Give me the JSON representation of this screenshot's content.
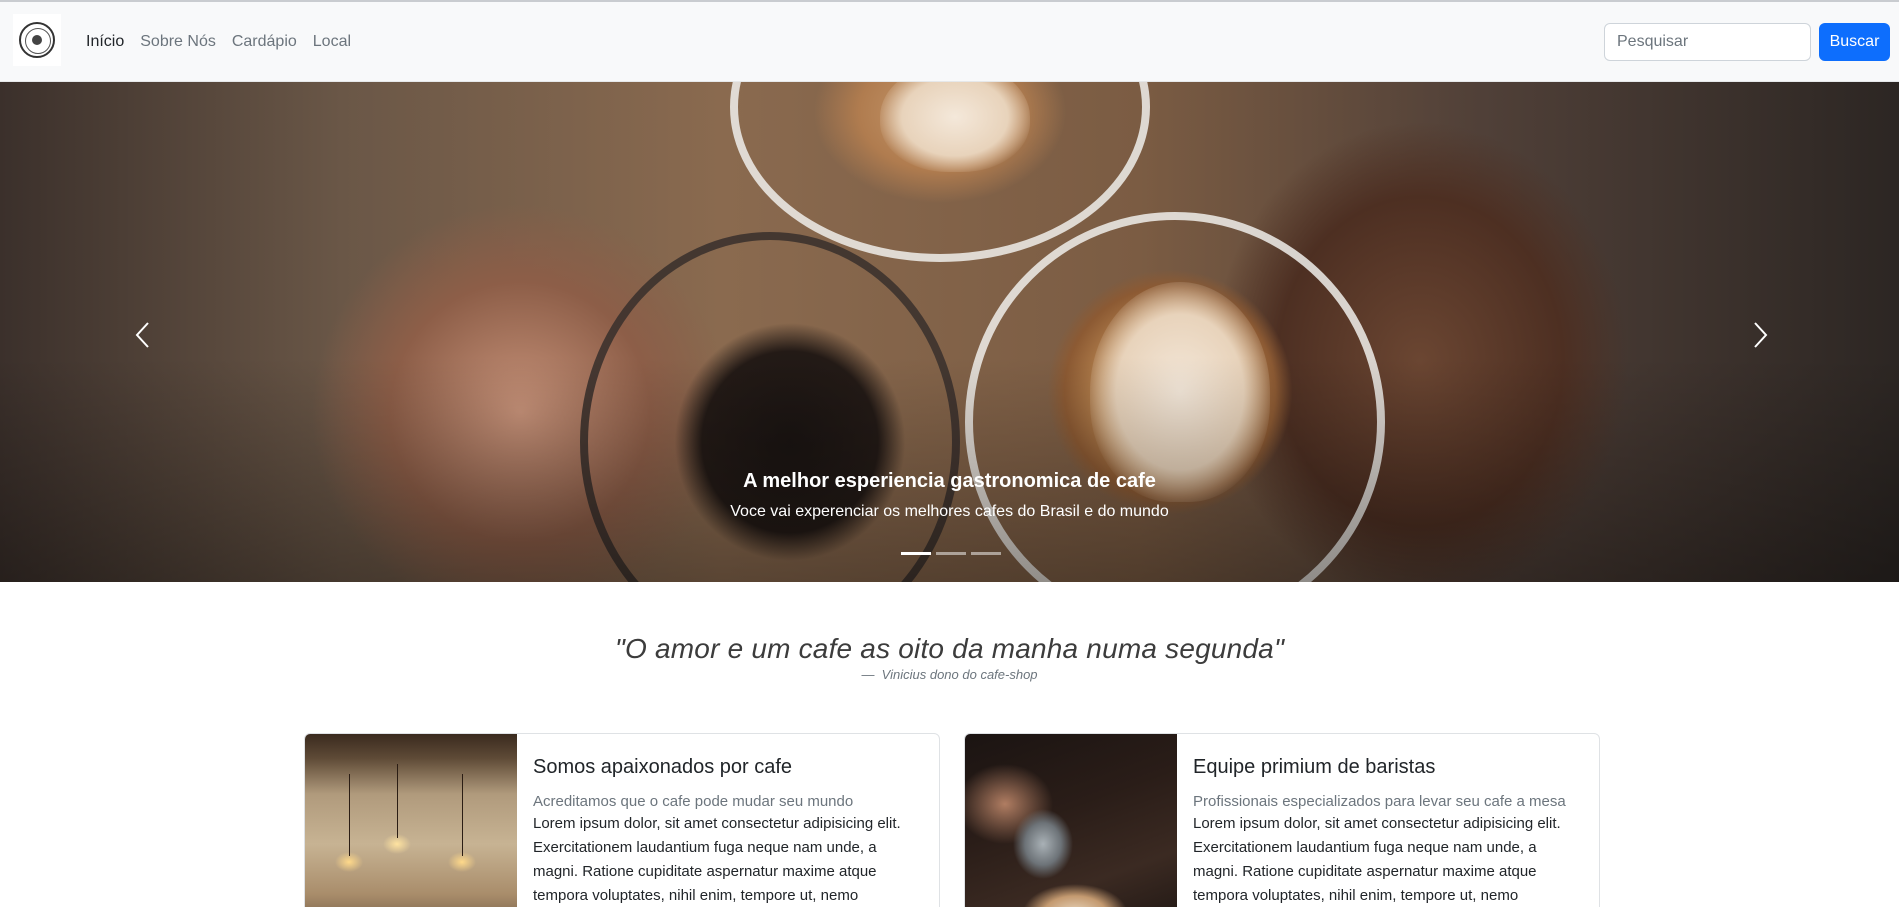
{
  "nav": {
    "logo": "logo-icon",
    "links": [
      "Início",
      "Sobre Nós",
      "Cardápio",
      "Local"
    ],
    "search_placeholder": "Pesquisar",
    "search_button": "Buscar"
  },
  "hero": {
    "title": "A melhor esperiencia gastronomica de cafe",
    "subtitle": "Voce vai experenciar os melhores cafes do Brasil e do mundo",
    "prev_icon": "chevron-left-icon",
    "next_icon": "chevron-right-icon",
    "slide_count": 3,
    "active_slide": 1
  },
  "quote": {
    "text": "\"O amor e um cafe as oito da manha numa segunda\"",
    "author": "Vinicius dono do cafe-shop"
  },
  "cards": [
    {
      "title": "Somos apaixonados por cafe",
      "subtitle": "Acreditamos que o cafe pode mudar seu mundo",
      "text": "Lorem ipsum dolor, sit amet consectetur adipisicing elit. Exercitationem laudantium fuga neque nam unde, a magni. Ratione cupiditate aspernatur maxime atque tempora voluptates, nihil enim, tempore ut, nemo"
    },
    {
      "title": "Equipe primium de baristas",
      "subtitle": "Profissionais especializados para levar seu cafe a mesa",
      "text": "Lorem ipsum dolor, sit amet consectetur adipisicing elit. Exercitationem laudantium fuga neque nam unde, a magni. Ratione cupiditate aspernatur maxime atque tempora voluptates, nihil enim, tempore ut, nemo"
    }
  ],
  "colors": {
    "primary": "#0d6efd",
    "navbar_bg": "#f8f9fa",
    "muted_text": "#6c757d"
  }
}
